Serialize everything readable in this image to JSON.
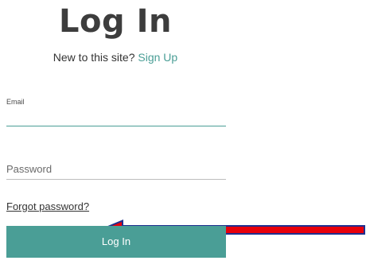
{
  "header": {
    "title": "Log In",
    "signup_prompt": "New to this site?",
    "signup_link": "Sign Up"
  },
  "form": {
    "email_label": "Email",
    "email_value": "",
    "password_placeholder": "Password",
    "forgot_password": "Forgot password?",
    "login_button": "Log In"
  },
  "annotation": {
    "arrow": "red-left-arrow",
    "arrow_fill": "#e8000b",
    "arrow_outline": "#1f2f8f"
  },
  "colors": {
    "accent": "#4a9e96",
    "text": "#3a3a3a",
    "divider": "#bdbdbd"
  }
}
